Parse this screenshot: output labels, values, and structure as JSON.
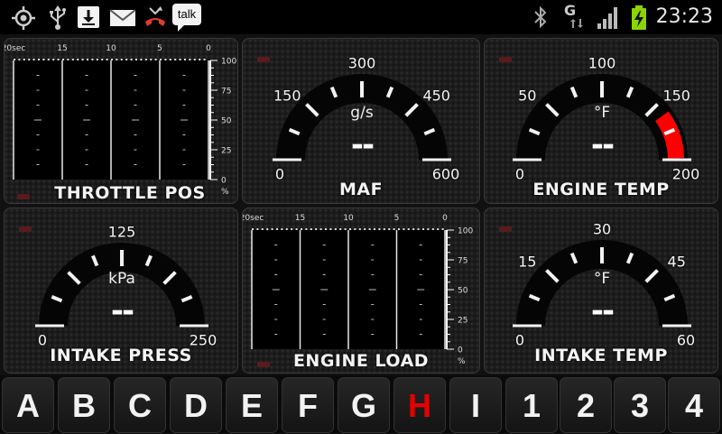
{
  "status_bar": {
    "icons": [
      "gps-icon",
      "usb-icon",
      "download-icon",
      "email-icon",
      "missed-call-icon",
      "talk-icon",
      "bluetooth-icon",
      "data-g-icon",
      "signal-icon",
      "battery-charging-icon"
    ],
    "talk_label": "talk",
    "data_letter": "G",
    "clock": "23:23"
  },
  "colors": {
    "accent_red": "#e60000",
    "redline": "#ff0000",
    "indicator": "#5a1b1b"
  },
  "gauges": [
    {
      "id": "maf",
      "title": "MAF",
      "unit": "g/s",
      "value": "--",
      "min": 0,
      "max": 600,
      "labels": [
        "0",
        "150",
        "300",
        "450",
        "600"
      ],
      "redline_start": null
    },
    {
      "id": "engine-temp",
      "title": "ENGINE TEMP",
      "unit": "°F",
      "value": "--",
      "min": 0,
      "max": 200,
      "labels": [
        "0",
        "50",
        "100",
        "150",
        "200"
      ],
      "redline_start": 160
    },
    {
      "id": "intake-press",
      "title": "INTAKE PRESS",
      "unit": "kPa",
      "value": "--",
      "min": 0,
      "max": 250,
      "labels": [
        "0",
        "",
        "125",
        "",
        "250"
      ],
      "redline_start": null
    },
    {
      "id": "intake-temp",
      "title": "INTAKE TEMP",
      "unit": "°F",
      "value": "--",
      "min": 0,
      "max": 60,
      "labels": [
        "0",
        "15",
        "30",
        "45",
        "60"
      ],
      "redline_start": null
    }
  ],
  "charts": [
    {
      "id": "throttle-pos",
      "title": "THROTTLE POS",
      "x_labels": [
        "20sec",
        "15",
        "10",
        "5",
        "0"
      ],
      "y_labels": [
        "100",
        "75",
        "50",
        "25",
        "0"
      ],
      "y_unit": "%"
    },
    {
      "id": "engine-load",
      "title": "ENGINE LOAD",
      "x_labels": [
        "20sec",
        "15",
        "10",
        "5",
        "0"
      ],
      "y_labels": [
        "100",
        "75",
        "50",
        "25",
        "0"
      ],
      "y_unit": "%"
    }
  ],
  "buttons": [
    "A",
    "B",
    "C",
    "D",
    "E",
    "F",
    "G",
    "H",
    "I",
    "1",
    "2",
    "3",
    "4"
  ],
  "active_button": "H"
}
